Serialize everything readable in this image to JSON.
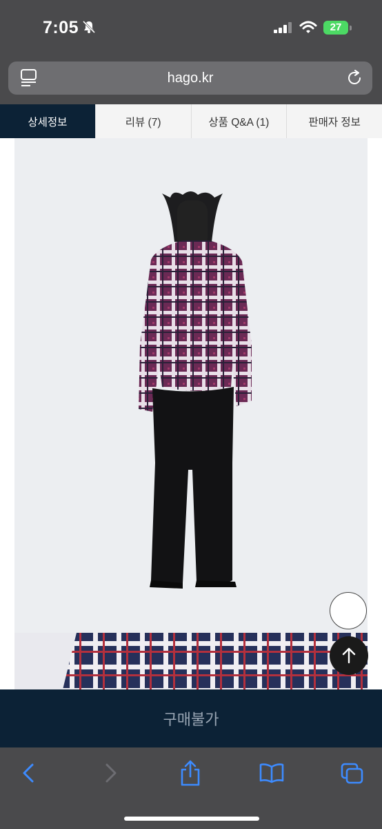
{
  "status_bar": {
    "time": "7:05",
    "battery": "27"
  },
  "address_bar": {
    "url": "hago.kr"
  },
  "tabs": [
    {
      "label": "상세정보",
      "active": true
    },
    {
      "label": "리뷰 (7)",
      "active": false
    },
    {
      "label": "상품 Q&A (1)",
      "active": false
    },
    {
      "label": "판매자 정보",
      "active": false
    }
  ],
  "buy_button": {
    "label": "구매불가"
  },
  "colors": {
    "navy": "#0c2236",
    "system_gray": "#4a4a4c",
    "ios_blue": "#3d8bff",
    "battery_green": "#4cd964"
  },
  "icons": {
    "status": [
      "bell-slash-icon",
      "signal-icon",
      "wifi-icon",
      "battery-icon"
    ],
    "address": [
      "reader-mode-icon",
      "reload-icon"
    ],
    "toolbar": [
      "back-icon",
      "forward-icon",
      "share-icon",
      "bookmarks-icon",
      "tabs-icon"
    ],
    "page": [
      "scroll-top-icon"
    ]
  }
}
